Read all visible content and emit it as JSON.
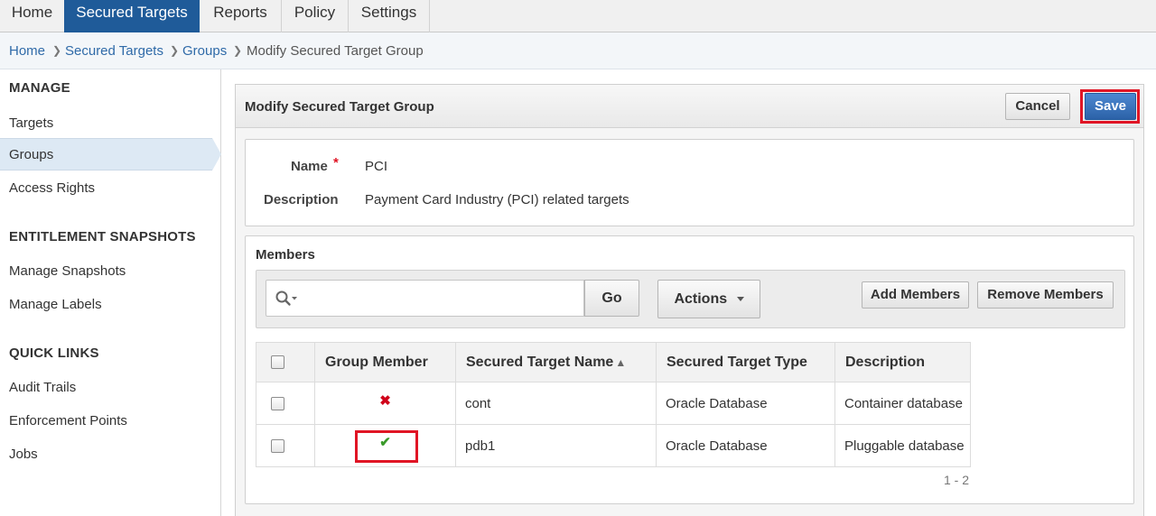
{
  "nav": {
    "tabs": [
      "Home",
      "Secured Targets",
      "Reports",
      "Policy",
      "Settings"
    ],
    "active_tab": "Secured Targets"
  },
  "breadcrumb": [
    "Home",
    "Secured Targets",
    "Groups",
    "Modify Secured Target Group"
  ],
  "sidebar": {
    "sections": [
      {
        "title": "MANAGE",
        "items": [
          "Targets",
          "Groups",
          "Access Rights"
        ]
      },
      {
        "title": "ENTITLEMENT SNAPSHOTS",
        "items": [
          "Manage Snapshots",
          "Manage Labels"
        ]
      },
      {
        "title": "QUICK LINKS",
        "items": [
          "Audit Trails",
          "Enforcement Points",
          "Jobs"
        ]
      }
    ],
    "selected_item": "Groups"
  },
  "region": {
    "title": "Modify Secured Target Group",
    "cancel_label": "Cancel",
    "save_label": "Save"
  },
  "form": {
    "name_label": "Name",
    "required_marker": "*",
    "name_value": "PCI",
    "description_label": "Description",
    "description_value": "Payment Card Industry (PCI) related targets"
  },
  "members": {
    "title": "Members",
    "search_placeholder": "",
    "go_label": "Go",
    "actions_label": "Actions",
    "add_label": "Add Members",
    "remove_label": "Remove Members",
    "columns": [
      "Group Member",
      "Secured Target Name",
      "Secured Target Type",
      "Description"
    ],
    "sort_indicator": "▲",
    "rows": [
      {
        "member": false,
        "member_icon": "x-mark-icon",
        "name": "cont",
        "type": "Oracle Database",
        "description": "Container database"
      },
      {
        "member": true,
        "member_icon": "check-mark-icon",
        "name": "pdb1",
        "type": "Oracle Database",
        "description": "Pluggable database"
      }
    ],
    "pagination": "1 - 2"
  },
  "colors": {
    "nav_active": "#1f5b99",
    "link": "#2f6aa8",
    "highlight_box": "#e01525",
    "save_button": "#2c62a8",
    "x_mark": "#d0021b",
    "check_mark": "#3a9a2a"
  }
}
